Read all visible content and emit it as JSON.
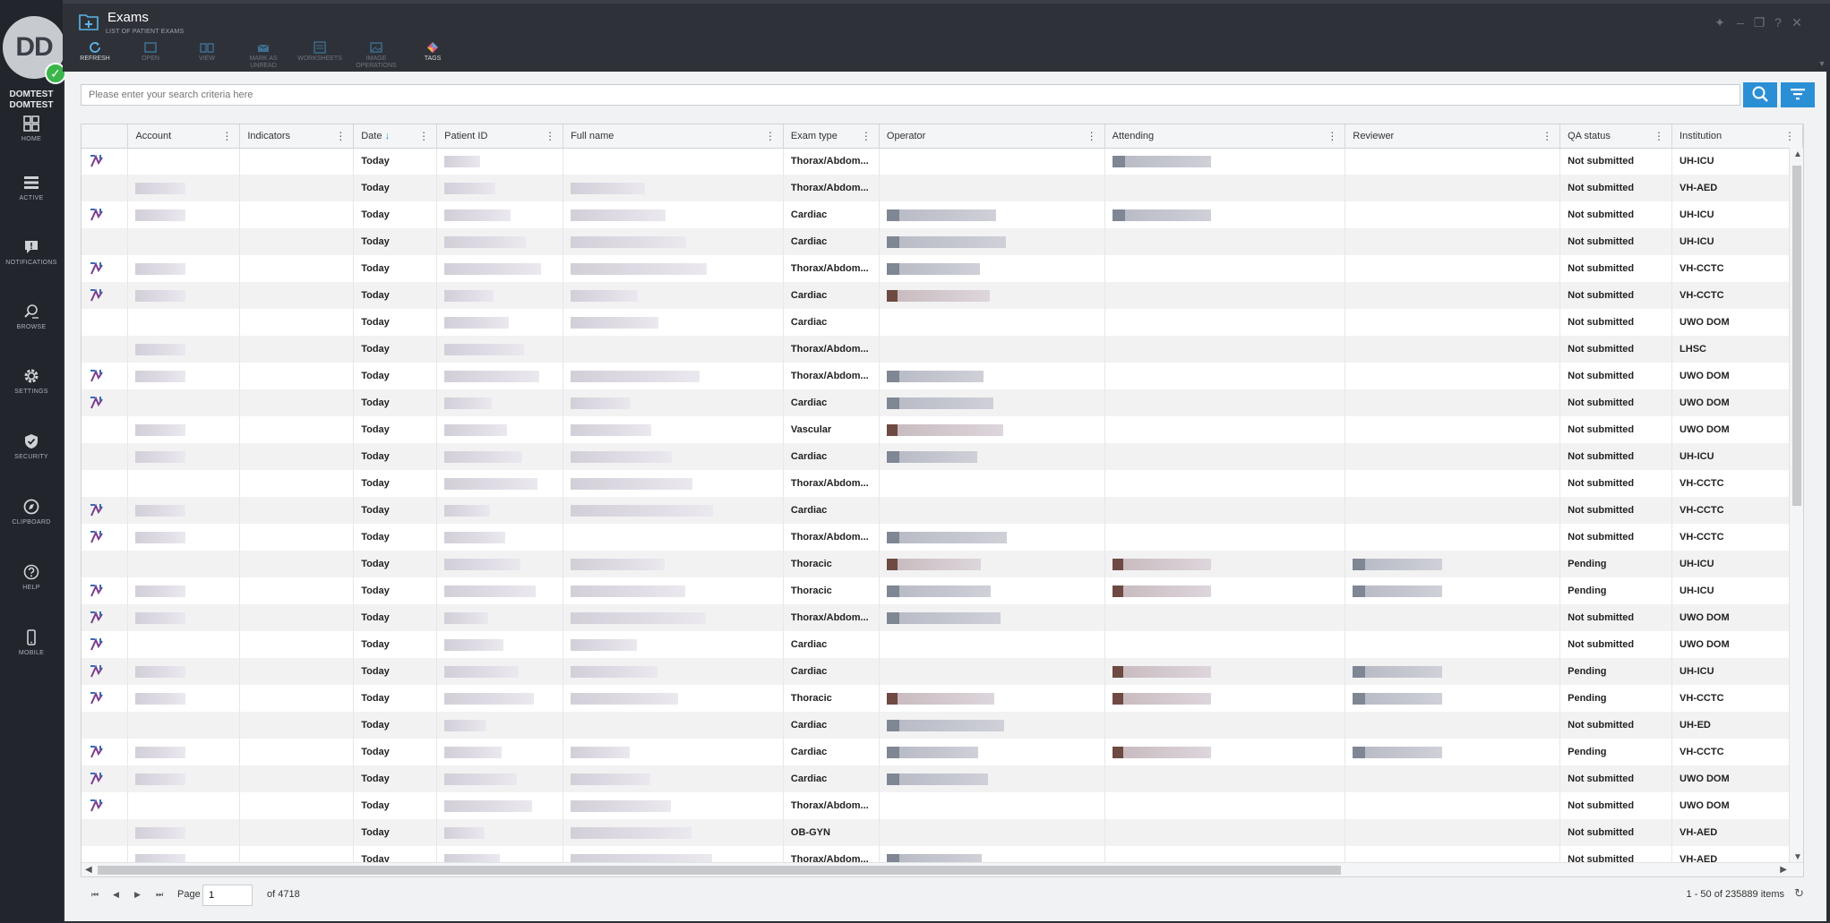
{
  "user": {
    "initials": "DD",
    "name_line1": "DOMTEST",
    "name_line2": "DOMTEST"
  },
  "nav": [
    {
      "label": "HOME",
      "icon": "home-icon"
    },
    {
      "label": "ACTIVE",
      "icon": "list-icon"
    },
    {
      "label": "NOTIFICATIONS",
      "icon": "notification-icon"
    },
    {
      "label": "BROWSE",
      "icon": "browse-icon"
    },
    {
      "label": "SETTINGS",
      "icon": "gear-icon"
    },
    {
      "label": "SECURITY",
      "icon": "shield-icon"
    },
    {
      "label": "CLIPBOARD",
      "icon": "clipboard-icon"
    },
    {
      "label": "HELP",
      "icon": "help-icon"
    },
    {
      "label": "MOBILE",
      "icon": "mobile-icon"
    }
  ],
  "window": {
    "title": "Exams",
    "subtitle": "LIST OF PATIENT EXAMS"
  },
  "toolbar": [
    {
      "label": "REFRESH",
      "enabled": true
    },
    {
      "label": "OPEN",
      "enabled": false
    },
    {
      "label": "VIEW",
      "enabled": false
    },
    {
      "label": "MARK AS UNREAD",
      "enabled": false
    },
    {
      "label": "WORKSHEETS",
      "enabled": false
    },
    {
      "label": "IMAGE OPERATIONS",
      "enabled": false
    },
    {
      "label": "TAGS",
      "enabled": true
    }
  ],
  "search": {
    "placeholder": "Please enter your search criteria here"
  },
  "columns": [
    "",
    "Account",
    "Indicators",
    "Date",
    "Patient ID",
    "Full name",
    "Exam type",
    "Operator",
    "Attending",
    "Reviewer",
    "QA status",
    "Institution"
  ],
  "rows": [
    {
      "icon": true,
      "date": "Today",
      "exam": "Thorax/Abdom...",
      "qa": "Not submitted",
      "inst": "UH-ICU"
    },
    {
      "icon": false,
      "date": "Today",
      "exam": "Thorax/Abdom...",
      "qa": "Not submitted",
      "inst": "VH-AED"
    },
    {
      "icon": true,
      "date": "Today",
      "exam": "Cardiac",
      "qa": "Not submitted",
      "inst": "UH-ICU"
    },
    {
      "icon": false,
      "date": "Today",
      "exam": "Cardiac",
      "qa": "Not submitted",
      "inst": "UH-ICU"
    },
    {
      "icon": true,
      "date": "Today",
      "exam": "Thorax/Abdom...",
      "qa": "Not submitted",
      "inst": "VH-CCTC"
    },
    {
      "icon": true,
      "date": "Today",
      "exam": "Cardiac",
      "qa": "Not submitted",
      "inst": "VH-CCTC"
    },
    {
      "icon": false,
      "date": "Today",
      "exam": "Cardiac",
      "qa": "Not submitted",
      "inst": "UWO DOM"
    },
    {
      "icon": false,
      "date": "Today",
      "exam": "Thorax/Abdom...",
      "qa": "Not submitted",
      "inst": "LHSC"
    },
    {
      "icon": true,
      "date": "Today",
      "exam": "Thorax/Abdom...",
      "qa": "Not submitted",
      "inst": "UWO DOM"
    },
    {
      "icon": true,
      "date": "Today",
      "exam": "Cardiac",
      "qa": "Not submitted",
      "inst": "UWO DOM"
    },
    {
      "icon": false,
      "date": "Today",
      "exam": "Vascular",
      "qa": "Not submitted",
      "inst": "UWO DOM"
    },
    {
      "icon": false,
      "date": "Today",
      "exam": "Cardiac",
      "qa": "Not submitted",
      "inst": "UH-ICU"
    },
    {
      "icon": false,
      "date": "Today",
      "exam": "Thorax/Abdom...",
      "qa": "Not submitted",
      "inst": "VH-CCTC"
    },
    {
      "icon": true,
      "date": "Today",
      "exam": "Cardiac",
      "qa": "Not submitted",
      "inst": "VH-CCTC"
    },
    {
      "icon": true,
      "date": "Today",
      "exam": "Thorax/Abdom...",
      "qa": "Not submitted",
      "inst": "VH-CCTC"
    },
    {
      "icon": false,
      "date": "Today",
      "exam": "Thoracic",
      "qa": "Pending",
      "inst": "UH-ICU"
    },
    {
      "icon": true,
      "date": "Today",
      "exam": "Thoracic",
      "qa": "Pending",
      "inst": "UH-ICU"
    },
    {
      "icon": true,
      "date": "Today",
      "exam": "Thorax/Abdom...",
      "qa": "Not submitted",
      "inst": "UWO DOM"
    },
    {
      "icon": true,
      "date": "Today",
      "exam": "Cardiac",
      "qa": "Not submitted",
      "inst": "UWO DOM"
    },
    {
      "icon": true,
      "date": "Today",
      "exam": "Cardiac",
      "qa": "Pending",
      "inst": "UH-ICU"
    },
    {
      "icon": true,
      "date": "Today",
      "exam": "Thoracic",
      "qa": "Pending",
      "inst": "VH-CCTC"
    },
    {
      "icon": false,
      "date": "Today",
      "exam": "Cardiac",
      "qa": "Not submitted",
      "inst": "UH-ED"
    },
    {
      "icon": true,
      "date": "Today",
      "exam": "Cardiac",
      "qa": "Pending",
      "inst": "VH-CCTC"
    },
    {
      "icon": true,
      "date": "Today",
      "exam": "Cardiac",
      "qa": "Not submitted",
      "inst": "UWO DOM"
    },
    {
      "icon": true,
      "date": "Today",
      "exam": "Thorax/Abdom...",
      "qa": "Not submitted",
      "inst": "UWO DOM"
    },
    {
      "icon": false,
      "date": "Today",
      "exam": "OB-GYN",
      "qa": "Not submitted",
      "inst": "VH-AED"
    },
    {
      "icon": false,
      "date": "Today",
      "exam": "Thorax/Abdom...",
      "qa": "Not submitted",
      "inst": "VH-AED"
    }
  ],
  "pager": {
    "page_label": "Page",
    "page": "1",
    "of_label": "of 4718",
    "summary": "1 - 50 of 235889 items"
  },
  "colors": {
    "accent": "#2b8fd6",
    "sidebar": "#22262c",
    "status_ok": "#3bb54a"
  }
}
